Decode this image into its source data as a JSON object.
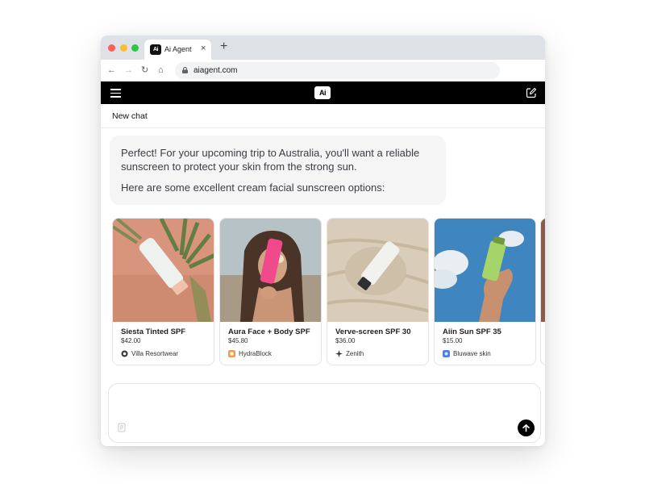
{
  "browser": {
    "tab_title": "Ai Agent",
    "tab_close": "×",
    "new_tab": "+",
    "url": "aiagent.com",
    "favicon_text": "Ai",
    "nav": {
      "back": "←",
      "forward": "→",
      "reload": "↻",
      "home": "⌂"
    }
  },
  "app": {
    "logo_text": "Ai",
    "chat_title": "New chat"
  },
  "message": {
    "paragraph_1": "Perfect! For your upcoming trip to Australia, you'll want a reliable sunscreen to protect your skin from the strong sun.",
    "paragraph_2": "Here are some excellent cream facial sunscreen options:"
  },
  "products": [
    {
      "name": "Siesta Tinted SPF",
      "price": "$42.00",
      "brand": "Villa Resortwear",
      "brand_icon": "villa-logo-icon",
      "brand_color": "#3a3a3a"
    },
    {
      "name": "Aura Face + Body SPF",
      "price": "$45.80",
      "brand": "HydraBlock",
      "brand_icon": "hydrablock-logo-icon",
      "brand_color": "#f2994a"
    },
    {
      "name": "Verve-screen SPF 30",
      "price": "$36.00",
      "brand": "Zenith",
      "brand_icon": "zenith-star-icon",
      "brand_color": "#333333"
    },
    {
      "name": "Aiin Sun SPF 35",
      "price": "$15.00",
      "brand": "Bluwave skin",
      "brand_icon": "bluwave-logo-icon",
      "brand_color": "#4f7cf0"
    }
  ],
  "composer": {
    "placeholder": ""
  },
  "colors": {
    "appbar": "#000000",
    "bubble": "#f5f5f6",
    "send_button": "#000000"
  }
}
